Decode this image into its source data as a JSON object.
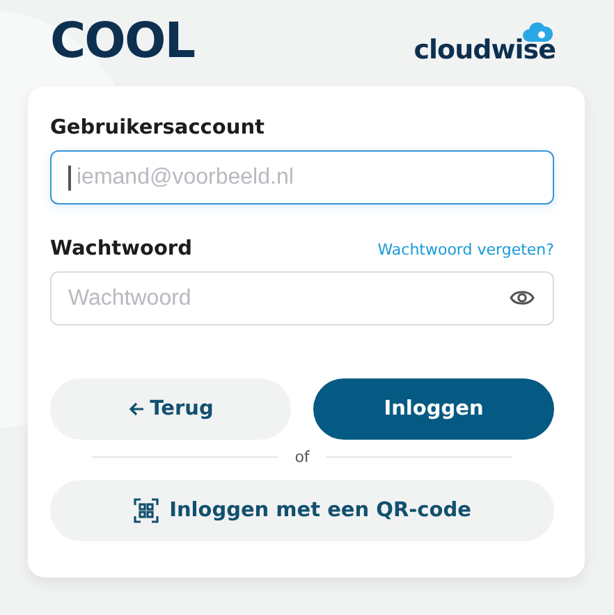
{
  "header": {
    "brand": "COOL",
    "partner": "cloudwise"
  },
  "form": {
    "fields": [
      {
        "label": "Gebruikersaccount",
        "placeholder": "iemand@voorbeeld.nl",
        "kind": "text",
        "focused": true
      },
      {
        "label": "Wachtwoord",
        "placeholder": "Wachtwoord",
        "kind": "password",
        "focused": false,
        "link": "Wachtwoord vergeten?"
      }
    ],
    "back_button": "Terug",
    "login_button": "Inloggen",
    "separator": "of",
    "qr_button": "Inloggen met een QR-code"
  }
}
